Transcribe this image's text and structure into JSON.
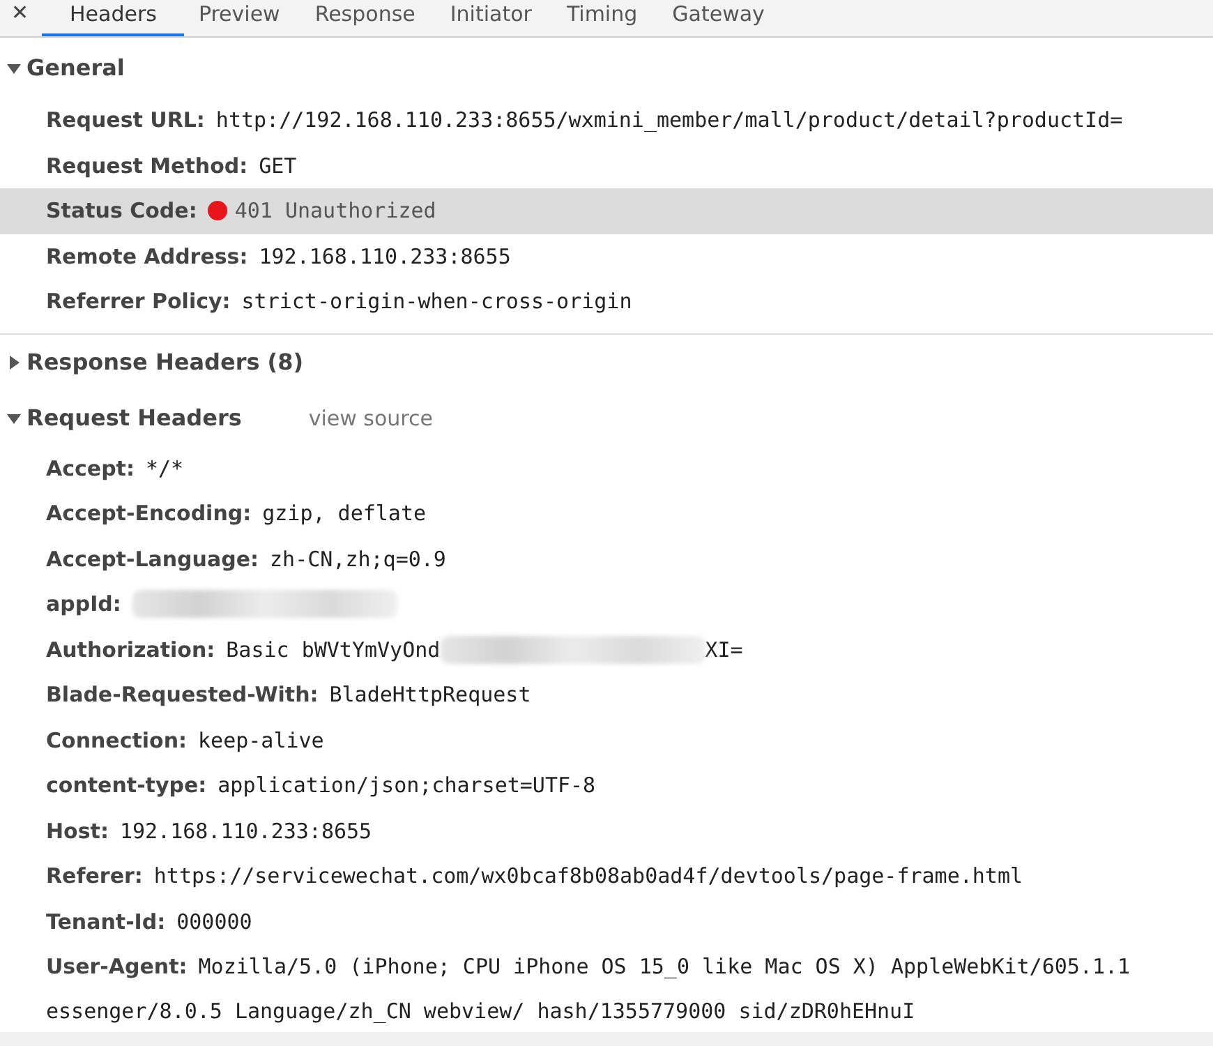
{
  "close": "✕",
  "tabs": [
    {
      "label": "Headers",
      "selected": true
    },
    {
      "label": "Preview",
      "selected": false
    },
    {
      "label": "Response",
      "selected": false
    },
    {
      "label": "Initiator",
      "selected": false
    },
    {
      "label": "Timing",
      "selected": false
    },
    {
      "label": "Gateway",
      "selected": false
    }
  ],
  "sections": [
    {
      "title": "General",
      "expanded": true,
      "rows": [
        {
          "name": "Request URL:",
          "value": "http://192.168.110.233:8655/wxmini_member/mall/product/detail?productId=",
          "selected": false
        },
        {
          "name": "Request Method:",
          "value": "GET",
          "selected": false
        },
        {
          "name": "Status Code:",
          "value": "401 Unauthorized",
          "color": "#e8141c",
          "selected": true
        },
        {
          "name": "Remote Address:",
          "value": "192.168.110.233:8655",
          "selected": false
        },
        {
          "name": "Referrer Policy:",
          "value": "strict-origin-when-cross-origin",
          "selected": false
        }
      ]
    },
    {
      "title": "Response Headers (8)",
      "expanded": false
    },
    {
      "title": "Request Headers",
      "expanded": true,
      "link": "view source",
      "rows": [
        {
          "name": "Accept:",
          "value": "*/*",
          "selected": false
        },
        {
          "name": "Accept-Encoding:",
          "value": "gzip, deflate",
          "selected": false
        },
        {
          "name": "Accept-Language:",
          "value": "zh-CN,zh;q=0.9",
          "selected": false
        },
        {
          "name": "appId:",
          "parts": [
            {
              "kind": "redacted"
            }
          ],
          "selected": false
        },
        {
          "name": "Authorization:",
          "parts": [
            {
              "kind": "text",
              "text": "Basic bWVtYmVyOnd"
            },
            {
              "kind": "redacted"
            },
            {
              "kind": "text",
              "text": "XI="
            }
          ],
          "selected": false
        },
        {
          "name": "Blade-Requested-With:",
          "value": "BladeHttpRequest",
          "selected": false
        },
        {
          "name": "Connection:",
          "value": "keep-alive",
          "selected": false
        },
        {
          "name": "content-type:",
          "value": "application/json;charset=UTF-8",
          "selected": false
        },
        {
          "name": "Host:",
          "value": "192.168.110.233:8655",
          "selected": false
        },
        {
          "name": "Referer:",
          "value": "https://servicewechat.com/wx0bcaf8b08ab0ad4f/devtools/page-frame.html",
          "selected": false
        },
        {
          "name": "Tenant-Id:",
          "value": "000000",
          "selected": false
        },
        {
          "name": "User-Agent:",
          "value": "Mozilla/5.0 (iPhone; CPU iPhone OS 15_0 like Mac OS X) AppleWebKit/605.1.1",
          "more": [
            "essenger/8.0.5 Language/zh_CN webview/ hash/1355779000 sid/zDR0hEHnuI"
          ],
          "selected": false
        }
      ]
    }
  ]
}
